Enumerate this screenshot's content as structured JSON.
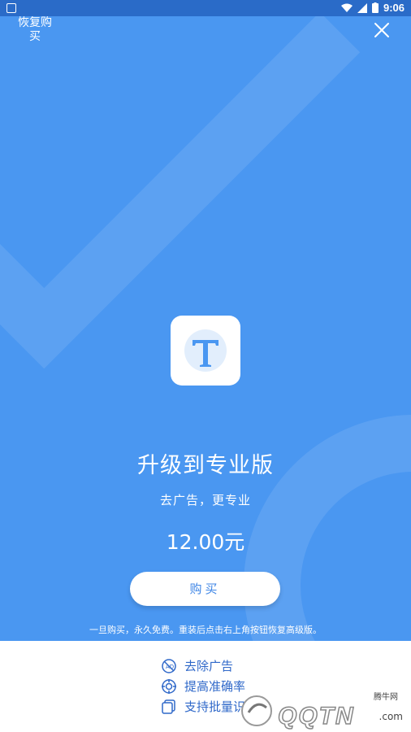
{
  "status_bar": {
    "time": "9:06"
  },
  "header": {
    "restore_label": "恢复购买"
  },
  "product": {
    "title": "升级到专业版",
    "subtitle": "去广告，更专业",
    "price": "12.00元",
    "buy_label": "购买",
    "notice": "一旦购买，永久免费。重装后点击右上角按钮恢复高级版。"
  },
  "features": [
    {
      "label": "去除广告",
      "icon": "no-ads-icon"
    },
    {
      "label": "提高准确率",
      "icon": "target-icon"
    },
    {
      "label": "支持批量识",
      "icon": "batch-icon"
    }
  ],
  "watermark": {
    "brand": "QQTN",
    "small": "腾牛网",
    "suffix": ".com"
  },
  "colors": {
    "hero_bg": "#4a97f1",
    "feature_text": "#2f68c9",
    "status_bar": "#2a6bc8"
  }
}
